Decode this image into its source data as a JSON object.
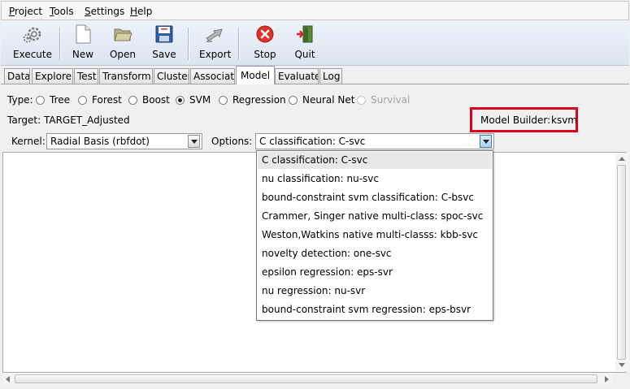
{
  "menubar": {
    "items": [
      {
        "first": "P",
        "rest": "roject"
      },
      {
        "first": "T",
        "rest": "ools"
      },
      {
        "first": "S",
        "rest": "ettings"
      },
      {
        "first": "H",
        "rest": "elp"
      }
    ]
  },
  "toolbar": {
    "execute": "Execute",
    "new": "New",
    "open": "Open",
    "save": "Save",
    "export": "Export",
    "stop": "Stop",
    "quit": "Quit"
  },
  "tabs": [
    "Data",
    "Explore",
    "Test",
    "Transform",
    "Cluster",
    "Associate",
    "Model",
    "Evaluate",
    "Log"
  ],
  "active_tab": "Model",
  "model": {
    "type_label": "Type:",
    "types": [
      "Tree",
      "Forest",
      "Boost",
      "SVM",
      "Regression",
      "Neural Net",
      "Survival"
    ],
    "selected_type": "SVM",
    "disabled_type": "Survival",
    "target_label": "Target: TARGET_Adjusted",
    "builder_label": "Model Builder:",
    "builder_value": "ksvm",
    "kernel_label": "Kernel:",
    "kernel_value": "Radial Basis (rbfdot)",
    "options_label": "Options:",
    "options_value": "C classification: C-svc",
    "options_list": [
      "C classification: C-svc",
      "nu classification: nu-svc",
      "bound-constraint svm classification: C-bsvc",
      "Crammer, Singer native multi-class: spoc-svc",
      "Weston,Watkins native multi-classs: kbb-svc",
      "novelty detection: one-svc",
      "epsilon regression: eps-svr",
      "nu regression: nu-svr",
      "bound-constraint svm regression: eps-bsvr"
    ]
  },
  "colors": {
    "highlight_border": "#e1001b",
    "toolbar_top": "#eef3fa",
    "toolbar_bottom": "#dbe5f1"
  }
}
